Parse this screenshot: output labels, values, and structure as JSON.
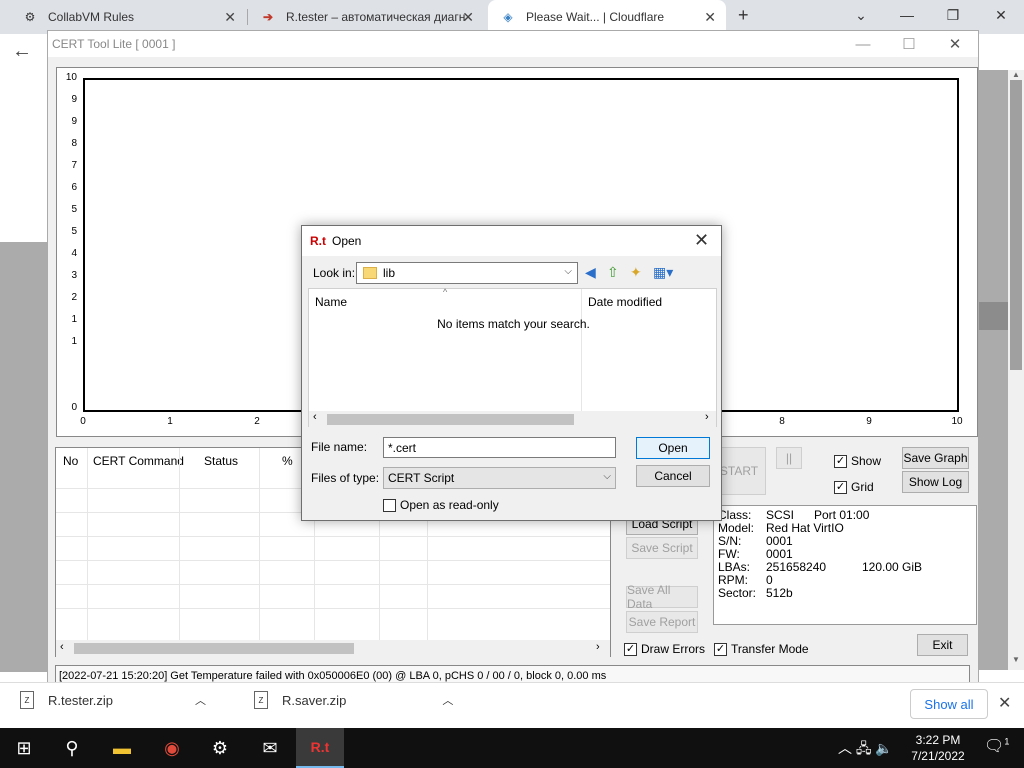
{
  "browser": {
    "tabs": [
      {
        "label": "CollabVM Rules",
        "icon": "collabvm-icon"
      },
      {
        "label": "R.tester – автоматическая диагн",
        "icon": "rtester-arrow-icon"
      },
      {
        "label": "Please Wait... | Cloudflare",
        "icon": "cloudflare-icon"
      }
    ],
    "new_tab": "+"
  },
  "cert_window": {
    "title": "CERT Tool Lite [ 0001 ]",
    "graph": {
      "y_ticks": [
        "10",
        "9",
        "9",
        "8",
        "7",
        "6",
        "5",
        "5",
        "4",
        "3",
        "2",
        "1",
        "1",
        "0"
      ],
      "x_ticks": [
        "0",
        "1",
        "2",
        "8",
        "9",
        "10"
      ]
    },
    "table": {
      "columns": [
        "No",
        "CERT Command",
        "Status",
        "%"
      ]
    },
    "buttons": {
      "start": "START",
      "pause": "||",
      "save_graph": "Save Graph",
      "show_log": "Show Log",
      "load_script": "Load Script",
      "save_script": "Save Script",
      "save_all_data": "Save All Data",
      "save_report": "Save Report",
      "exit": "Exit"
    },
    "checkboxes": {
      "show": {
        "label": "Show",
        "checked": true
      },
      "grid": {
        "label": "Grid",
        "checked": true
      },
      "draw_errors": {
        "label": "Draw Errors",
        "checked": true
      },
      "transfer_mode": {
        "label": "Transfer Mode",
        "checked": true
      }
    },
    "info": {
      "class_label": "Class:",
      "class_value": "SCSI",
      "port": "Port 01:00",
      "model_label": "Model:",
      "model_value": "Red Hat VirtIO",
      "sn_label": "S/N:",
      "sn_value": "0001",
      "fw_label": "FW:",
      "fw_value": "0001",
      "lbas_label": "LBAs:",
      "lbas_value": "251658240",
      "size": "120.00 GiB",
      "rpm_label": "RPM:",
      "rpm_value": "0",
      "sector_label": "Sector:",
      "sector_value": "512b"
    },
    "status": "[2022-07-21 15:20:20] Get Temperature failed with 0x050006E0 (00) @ LBA 0, pCHS 0 / 00 / 0, block 0, 0.00 ms"
  },
  "open_dialog": {
    "logo": "R.t",
    "title": "Open",
    "look_in_label": "Look in:",
    "look_in_value": "lib",
    "col_name": "Name",
    "col_date": "Date modified",
    "empty_message": "No items match your search.",
    "file_name_label": "File name:",
    "file_name_value": "*.cert",
    "files_of_type_label": "Files of type:",
    "files_of_type_value": "CERT Script",
    "read_only_label": "Open as read-only",
    "open_button": "Open",
    "cancel_button": "Cancel"
  },
  "downloads": {
    "items": [
      "R.tester.zip",
      "R.saver.zip"
    ],
    "show_all": "Show all"
  },
  "taskbar": {
    "time": "3:22 PM",
    "date": "7/21/2022",
    "notifications": "1"
  }
}
